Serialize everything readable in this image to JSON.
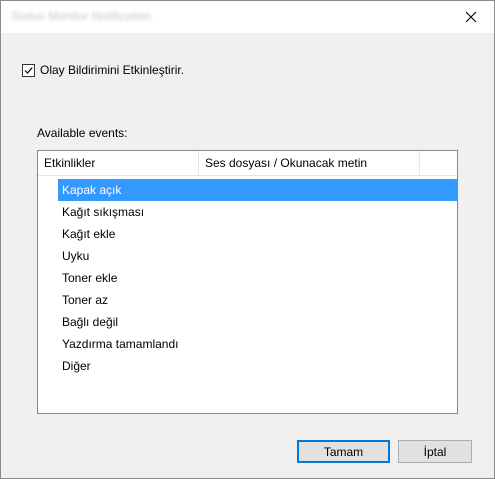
{
  "window": {
    "title": "Status Monitor Notification"
  },
  "enable_checkbox": {
    "label": "Olay Bildirimini Etkinleştirir.",
    "checked": true
  },
  "events": {
    "label": "Available events:",
    "columns": [
      "Etkinlikler",
      "Ses dosyası / Okunacak metin"
    ],
    "items": [
      "Kapak açık",
      "Kağıt sıkışması",
      "Kağıt ekle",
      "Uyku",
      "Toner ekle",
      "Toner az",
      "Bağlı değil",
      "Yazdırma tamamlandı",
      "Diğer"
    ],
    "selected_index": 0
  },
  "buttons": {
    "ok": "Tamam",
    "cancel": "İptal"
  },
  "colors": {
    "selection": "#3399ff",
    "default_button_border": "#0078d7"
  },
  "icons": {
    "close": "close-icon",
    "check": "checkmark-icon"
  }
}
